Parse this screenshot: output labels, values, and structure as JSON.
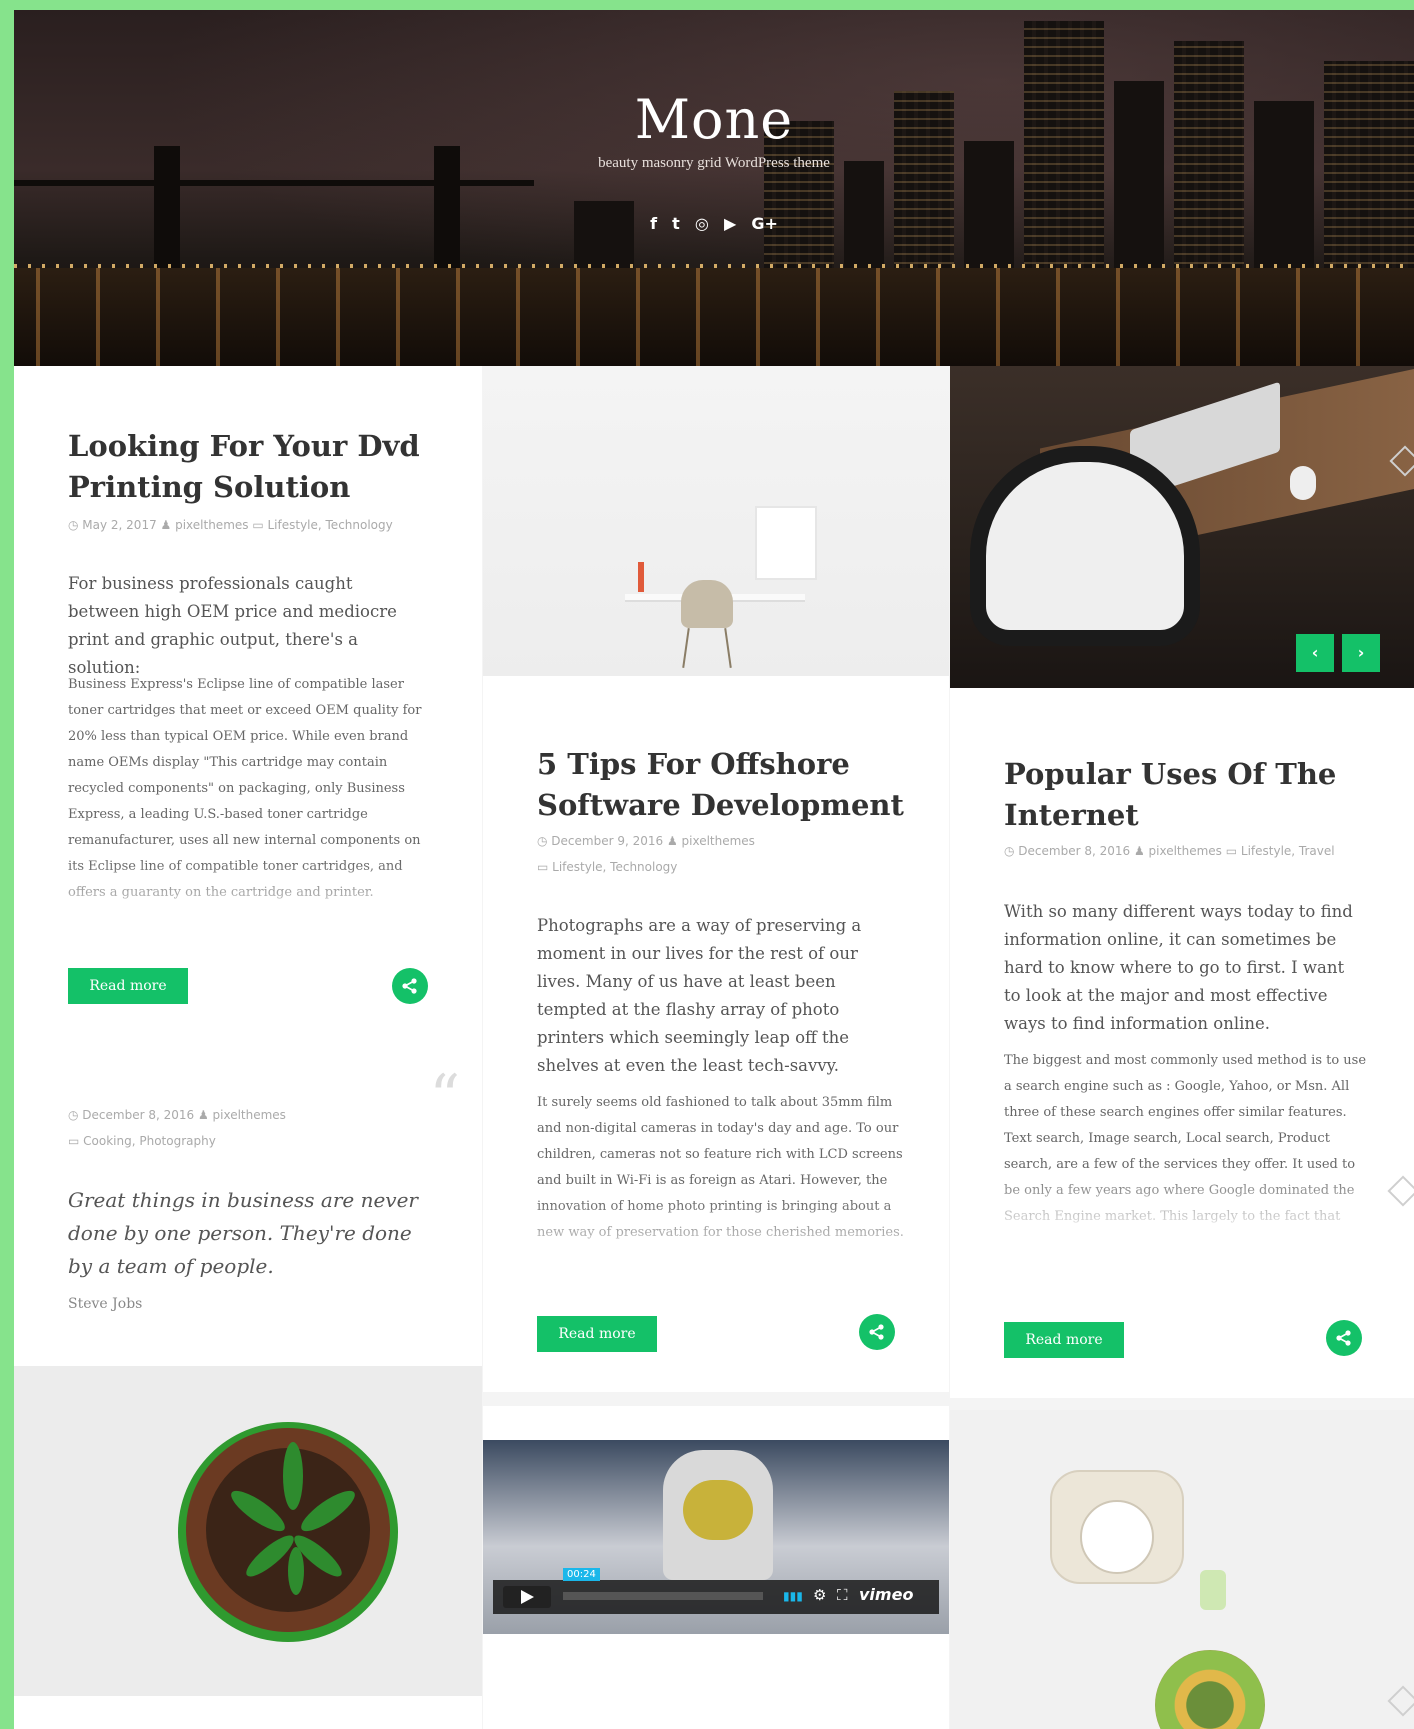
{
  "site": {
    "title": "Mone",
    "tagline": "beauty masonry grid WordPress theme",
    "social_icons": [
      "facebook-icon",
      "twitter-icon",
      "instagram-icon",
      "youtube-icon",
      "google-plus-icon"
    ],
    "social_glyphs": [
      "f",
      "t",
      "◎",
      "▶",
      "G+"
    ]
  },
  "colors": {
    "accent": "#14c168",
    "background_frame": "#86e38c"
  },
  "posts": [
    {
      "title_line1": "Looking For Your Dvd",
      "title_line2": "Printing Solution",
      "meta": "◷ May 2, 2017   ♟ pixelthemes   ▭ Lifestyle, Technology",
      "lead": "For business professionals caught between high OEM price and mediocre print and graphic output, there's a solution:",
      "body": "Business Express's Eclipse line of compatible laser toner cartridges that meet or exceed OEM quality for 20% less than typical OEM price. While even brand name OEMs display \"This cartridge may contain recycled components\" on packaging, only Business Express, a leading U.S.-based toner cartridge remanufacturer, uses all new internal components on its Eclipse line of compatible toner cartridges, and offers a guaranty on the cartridge and printer.",
      "button": "Read more"
    },
    {
      "title_line1": "5 Tips For Offshore",
      "title_line2": "Software Development",
      "meta_line1": "◷ December 9, 2016   ♟ pixelthemes",
      "meta_line2": "▭ Lifestyle, Technology",
      "lead": "Photographs are a way of preserving a moment in our lives for the rest of our lives. Many of us have at least been tempted at the flashy array of photo printers which seemingly leap off the shelves at even the least tech-savvy.",
      "body": "It surely seems old fashioned to talk about 35mm film and non-digital cameras in today's day and age. To our children, cameras not so feature rich with LCD screens and built in Wi-Fi is as foreign as Atari. However, the innovation of home photo printing is bringing about a new way of preservation for those cherished memories.",
      "button": "Read more"
    },
    {
      "title_line1": "Popular Uses Of The",
      "title_line2": "Internet",
      "meta": "◷ December 8, 2016   ♟ pixelthemes   ▭ Lifestyle, Travel",
      "lead": "With so many different ways today to find information online, it can sometimes be hard to know where to go to first. I want to look at the major and most effective ways to find information online.",
      "body": "The biggest and most commonly used method is to use a search engine such as : Google, Yahoo, or Msn. All three of these search engines offer similar features. Text search, Image search, Local search, Product search, are a few of the services they offer. It used to be only a few years ago where Google dominated the Search Engine market. This largely to the fact that their search performance was the most successful.",
      "button": "Read more"
    }
  ],
  "quote": {
    "meta_line1": "◷ December 8, 2016   ♟ pixelthemes",
    "meta_line2": "▭ Cooking, Photography",
    "text": "Great things in business are never done by one person. They're done by a team of people.",
    "author": "Steve Jobs"
  },
  "slider": {
    "prev": "‹",
    "next": "›"
  },
  "video": {
    "time": "00:24",
    "brand": "vimeo"
  }
}
